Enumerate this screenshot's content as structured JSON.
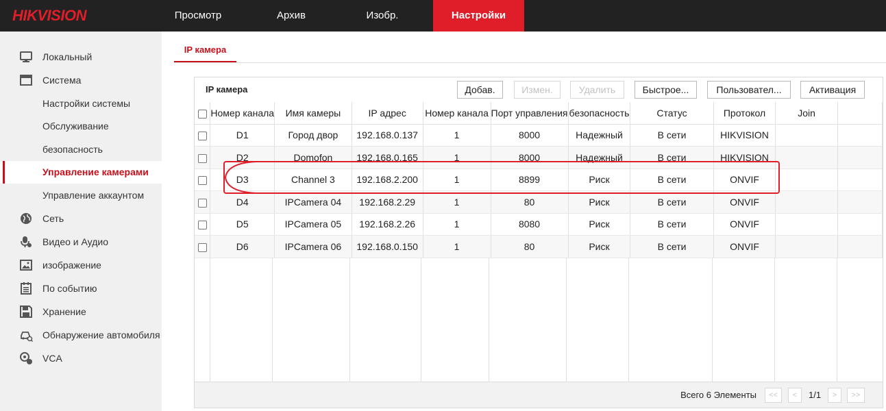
{
  "brand": {
    "logo": "HIKVISION",
    "accent": "#e01e2a"
  },
  "nav": [
    {
      "label": "Просмотр"
    },
    {
      "label": "Архив"
    },
    {
      "label": "Изобр."
    },
    {
      "label": "Настройки",
      "active": true
    }
  ],
  "sidebar": {
    "items": [
      {
        "label": "Локальный",
        "icon": "monitor-icon"
      },
      {
        "label": "Система",
        "icon": "window-icon"
      },
      {
        "label": "Настройки системы"
      },
      {
        "label": "Обслуживание"
      },
      {
        "label": "безопасность"
      },
      {
        "label": "Управление камерами",
        "active": true
      },
      {
        "label": "Управление аккаунтом"
      },
      {
        "label": "Сеть",
        "icon": "globe-icon"
      },
      {
        "label": "Видео и Аудио",
        "icon": "mic-icon"
      },
      {
        "label": "изображение",
        "icon": "image-icon"
      },
      {
        "label": "По событию",
        "icon": "calendar-icon"
      },
      {
        "label": "Хранение",
        "icon": "save-icon"
      },
      {
        "label": "Обнаружение автомобиля",
        "icon": "car-icon"
      },
      {
        "label": "VCA",
        "icon": "vca-icon"
      }
    ]
  },
  "tab": {
    "label": "IP камера"
  },
  "panel": {
    "title": "IP камера",
    "buttons": {
      "add": "Добав.",
      "edit": "Измен.",
      "delete": "Удалить",
      "quick": "Быстрое...",
      "custom": "Пользовател...",
      "activate": "Активация"
    }
  },
  "table": {
    "headers": [
      "Номер канала",
      "Имя камеры",
      "IP адрес",
      "Номер канала",
      "Порт управления",
      "безопасность",
      "Статус",
      "Протокол",
      "Join"
    ],
    "rows": [
      [
        "D1",
        "Город двор",
        "192.168.0.137",
        "1",
        "8000",
        "Надежный",
        "В сети",
        "HIKVISION",
        ""
      ],
      [
        "D2",
        "Domofon",
        "192.168.0.165",
        "1",
        "8000",
        "Надежный",
        "В сети",
        "HIKVISION",
        ""
      ],
      [
        "D3",
        "Channel 3",
        "192.168.2.200",
        "1",
        "8899",
        "Риск",
        "В сети",
        "ONVIF",
        ""
      ],
      [
        "D4",
        "IPCamera 04",
        "192.168.2.29",
        "1",
        "80",
        "Риск",
        "В сети",
        "ONVIF",
        ""
      ],
      [
        "D5",
        "IPCamera 05",
        "192.168.2.26",
        "1",
        "8080",
        "Риск",
        "В сети",
        "ONVIF",
        ""
      ],
      [
        "D6",
        "IPCamera 06",
        "192.168.0.150",
        "1",
        "80",
        "Риск",
        "В сети",
        "ONVIF",
        ""
      ]
    ]
  },
  "footer": {
    "total": "Всего 6 Элементы",
    "page": "1/1",
    "first": "<<",
    "prev": "<",
    "next": ">",
    "last": ">>"
  }
}
